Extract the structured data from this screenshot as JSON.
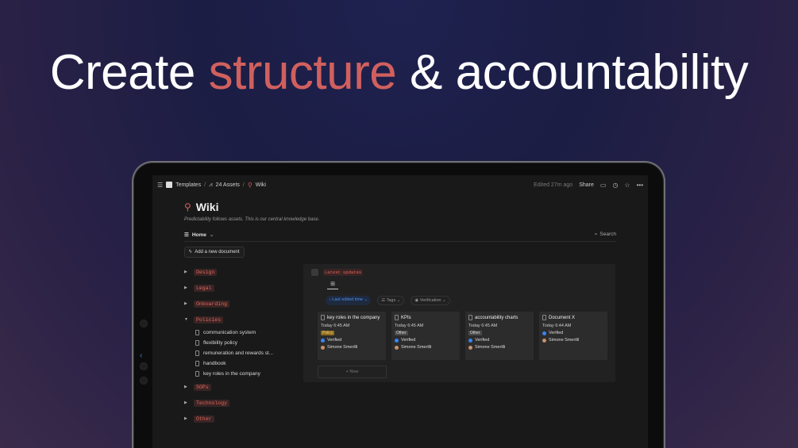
{
  "headline": {
    "part1": "Create ",
    "accent": "structure",
    "part2": " & accountability"
  },
  "colors": {
    "accent": "#d0605e",
    "tag_bg": "#3a2424",
    "tag_fg": "#e0665a",
    "link_blue": "#4e8ef0"
  },
  "topbar": {
    "breadcrumb": [
      "Templates",
      "24 Assets",
      "Wiki"
    ],
    "edited": "Edited 27m ago",
    "share": "Share",
    "icons": [
      "menu-icon",
      "comment-icon",
      "clock-icon",
      "star-icon",
      "more-icon"
    ]
  },
  "page": {
    "title": "Wiki",
    "subtitle": "Predictability follows assets. This is our central knowledge base.",
    "view": "Home",
    "search": "Search",
    "add_document": "Add a new document"
  },
  "tree": {
    "design": "Design",
    "legal": "Legal",
    "onboarding": "Onboarding",
    "policies": "Policies",
    "policies_children": [
      "communication system",
      "flexibility policy",
      "remuneration and rewards st...",
      "handbook",
      "key roles in the company"
    ],
    "sops": "SOPs",
    "technology": "Technology",
    "other": "Other"
  },
  "panel": {
    "tag": "Latest updates",
    "filters": {
      "sort": "Last edited time",
      "tags": "Tags",
      "verification": "Verification"
    },
    "cards": [
      {
        "title": "key roles in the company",
        "date": "Today 6:45 AM",
        "tag": "Policy",
        "verified": "Verified",
        "user": "Simone Smerilli"
      },
      {
        "title": "KPIs",
        "date": "Today 6:45 AM",
        "tag": "Other",
        "verified": "Verified",
        "user": "Simone Smerilli"
      },
      {
        "title": "accountability charts",
        "date": "Today 6:45 AM",
        "tag": "Other",
        "verified": "Verified",
        "user": "Simone Smerilli"
      },
      {
        "title": "Document X",
        "date": "Today 6:44 AM",
        "verified": "Verified",
        "user": "Simone Smerilli"
      }
    ],
    "new": "+ New"
  }
}
